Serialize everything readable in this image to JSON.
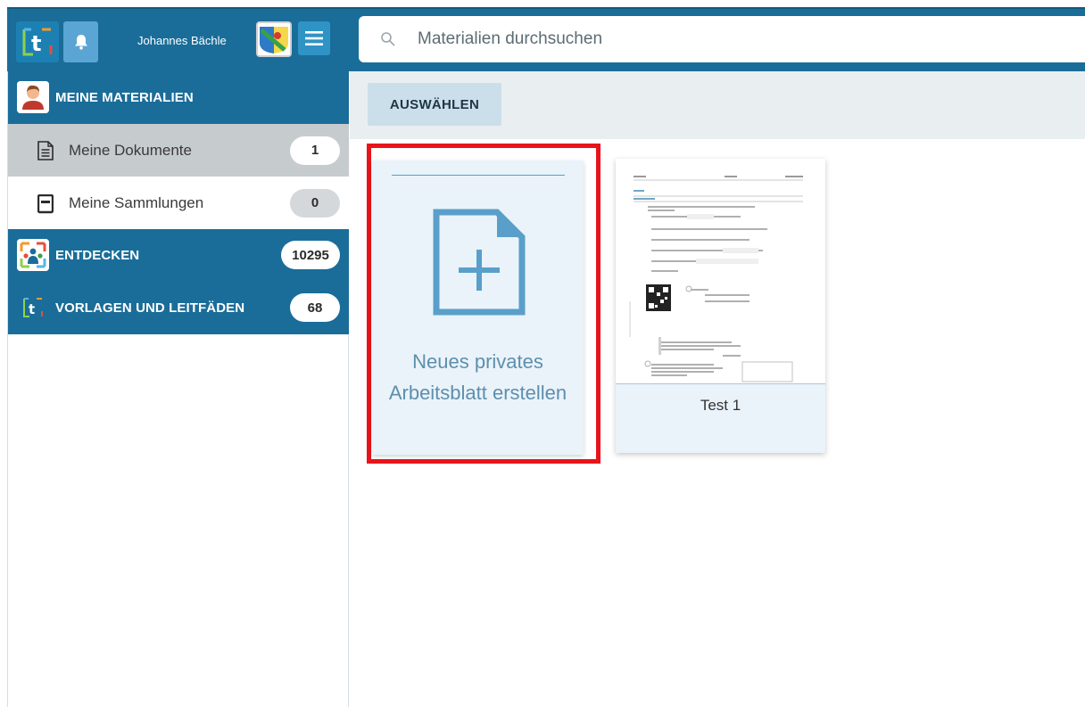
{
  "header": {
    "user_name": "Johannes Bächle",
    "search_placeholder": "Materialien durchsuchen"
  },
  "sidebar": {
    "sections": [
      {
        "label": "MEINE MATERIALIEN"
      },
      {
        "label": "ENTDECKEN",
        "count": "10295"
      },
      {
        "label": "VORLAGEN UND LEITFÄDEN",
        "count": "68"
      }
    ],
    "items": [
      {
        "label": "Meine Dokumente",
        "count": "1"
      },
      {
        "label": "Meine Sammlungen",
        "count": "0"
      }
    ]
  },
  "toolbar": {
    "select_label": "AUSWÄHLEN"
  },
  "main": {
    "new_card_caption": "Neues privates Arbeitsblatt erstellen",
    "documents": [
      {
        "title": "Test 1"
      }
    ]
  },
  "colors": {
    "brand_blue": "#1a6d99",
    "highlight_red": "#e8141b",
    "card_bg": "#eaf3f9"
  }
}
